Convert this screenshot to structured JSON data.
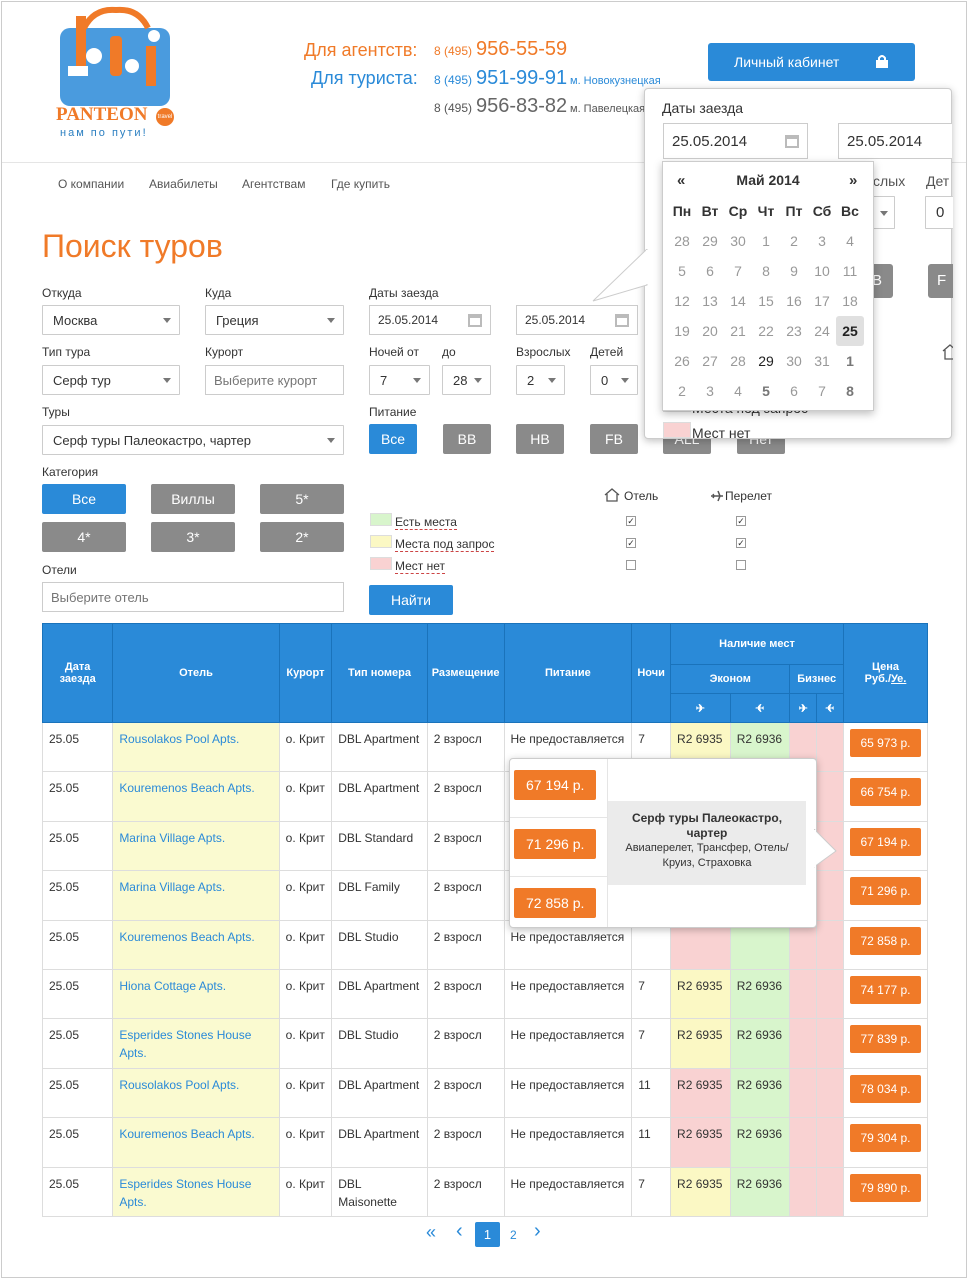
{
  "header": {
    "logo_text": "PANTEON",
    "logo_travel": "travel",
    "logo_slogan": "нам по пути!",
    "agency_label": "Для агентств:",
    "agency_code": "8 (495)",
    "agency_phone": "956-55-59",
    "tourist_label": "Для туриста:",
    "tourist_code": "8 (495)",
    "tourist_phone": "951-99-91",
    "tourist_metro": "м. Новокузнецкая",
    "phone3_code": "8 (495)",
    "phone3": "956-83-82",
    "phone3_metro": "м. Павелецкая",
    "cabinet_label": "Личный кабинет"
  },
  "nav": [
    "О компании",
    "Авиабилеты",
    "Агентствам",
    "Где купить"
  ],
  "page_title": "Поиск туров",
  "form": {
    "from_label": "Откуда",
    "from_value": "Москва",
    "to_label": "Куда",
    "to_value": "Греция",
    "dates_label": "Даты заезда",
    "date_from": "25.05.2014",
    "date_to": "25.05.2014",
    "tour_type_label": "Тип тура",
    "tour_type_value": "Серф тур",
    "resort_label": "Курорт",
    "resort_placeholder": "Выберите курорт",
    "nights_from_label": "Ночей от",
    "nights_from": "7",
    "nights_to_label": "до",
    "nights_to": "28",
    "adults_label": "Взрослых",
    "adults": "2",
    "children_label": "Детей",
    "children": "0",
    "tours_label": "Туры",
    "tours_value": "Серф туры Палеокастро, чартер",
    "meal_label": "Питание",
    "meal_buttons": [
      "Все",
      "BB",
      "HB",
      "FB",
      "ALL",
      "Нет"
    ],
    "category_label": "Категория",
    "category_buttons": [
      "Все",
      "Виллы",
      "5*",
      "4*",
      "3*",
      "2*"
    ],
    "hotels_label": "Отели",
    "hotels_placeholder": "Выберите отель",
    "legend": [
      "Есть места",
      "Места под запрос",
      "Мест нет"
    ],
    "hotel_col": "Отель",
    "flight_col": "Перелет",
    "search_button": "Найти"
  },
  "datepicker": {
    "label": "Даты заезда",
    "date_from": "25.05.2014",
    "date_to": "25.05.2014",
    "prev": "«",
    "next": "»",
    "month": "Май 2014",
    "weekdays": [
      "Пн",
      "Вт",
      "Ср",
      "Чт",
      "Пт",
      "Сб",
      "Вс"
    ],
    "weeks": [
      [
        "28",
        "29",
        "30",
        "1",
        "2",
        "3",
        "4"
      ],
      [
        "5",
        "6",
        "7",
        "8",
        "9",
        "10",
        "11"
      ],
      [
        "12",
        "13",
        "14",
        "15",
        "16",
        "17",
        "18"
      ],
      [
        "19",
        "20",
        "21",
        "22",
        "23",
        "24",
        "25"
      ],
      [
        "26",
        "27",
        "28",
        "29",
        "30",
        "31",
        "1"
      ],
      [
        "2",
        "3",
        "4",
        "5",
        "6",
        "7",
        "8"
      ]
    ],
    "peek_adults": "слых",
    "peek_children": "Дет",
    "peek_zero": "0",
    "peek_b": "B",
    "peek_f": "F",
    "peek_legend_request": "Места под запрос",
    "peek_legend_none": "Мест нет"
  },
  "table": {
    "headers": {
      "date": "Дата заезда",
      "hotel": "Отель",
      "resort": "Курорт",
      "room": "Тип номера",
      "place": "Размещение",
      "meal": "Питание",
      "nights": "Ночи",
      "avail": "Наличие мест",
      "econom": "Эконом",
      "business": "Бизнес",
      "price": "Цена",
      "price_cur": "Руб./",
      "price_cur2": "Уе."
    },
    "rows": [
      {
        "date": "25.05",
        "hotel": "Rousolakos Pool Apts.",
        "resort": "о. Крит",
        "room": "DBL Apartment",
        "place": "2 взросл",
        "meal": "Не предоставляется",
        "nights": "7",
        "e1": "R2 6935",
        "e2": "R2 6936",
        "c1": "y",
        "c2": "g",
        "price": "65 973 р."
      },
      {
        "date": "25.05",
        "hotel": "Kouremenos Beach Apts.",
        "resort": "о. Крит",
        "room": "DBL Apartment",
        "place": "2 взросл",
        "meal": "Не предоставляется",
        "nights": "",
        "e1": "",
        "e2": "",
        "c1": "y",
        "c2": "g",
        "price": "66 754 р."
      },
      {
        "date": "25.05",
        "hotel": "Marina Village Apts.",
        "resort": "о. Крит",
        "room": "DBL Standard",
        "place": "2 взросл",
        "meal": "",
        "nights": "",
        "e1": "",
        "e2": "",
        "c1": "y",
        "c2": "g",
        "price": "67 194 р."
      },
      {
        "date": "25.05",
        "hotel": "Marina Village Apts.",
        "resort": "о. Крит",
        "room": "DBL Family",
        "place": "2 взросл",
        "meal": "",
        "nights": "",
        "e1": "",
        "e2": "",
        "c1": "y",
        "c2": "g",
        "price": "71 296 р."
      },
      {
        "date": "25.05",
        "hotel": "Kouremenos Beach Apts.",
        "resort": "о. Крит",
        "room": "DBL Studio",
        "place": "2 взросл",
        "meal": "Не предоставляется",
        "nights": "",
        "e1": "",
        "e2": "",
        "c1": "r",
        "c2": "g",
        "price": "72 858 р."
      },
      {
        "date": "25.05",
        "hotel": "Hiona Cottage Apts.",
        "resort": "о. Крит",
        "room": "DBL Apartment",
        "place": "2 взросл",
        "meal": "Не предоставляется",
        "nights": "7",
        "e1": "R2 6935",
        "e2": "R2 6936",
        "c1": "y",
        "c2": "g",
        "price": "74 177 р."
      },
      {
        "date": "25.05",
        "hotel": "Esperides Stones House Apts.",
        "resort": "о. Крит",
        "room": "DBL Studio",
        "place": "2 взросл",
        "meal": "Не предоставляется",
        "nights": "7",
        "e1": "R2 6935",
        "e2": "R2 6936",
        "c1": "y",
        "c2": "g",
        "price": "77 839 р."
      },
      {
        "date": "25.05",
        "hotel": "Rousolakos Pool Apts.",
        "resort": "о. Крит",
        "room": "DBL Apartment",
        "place": "2 взросл",
        "meal": "Не предоставляется",
        "nights": "11",
        "e1": "R2 6935",
        "e2": "R2 6936",
        "c1": "r",
        "c2": "g",
        "price": "78 034 р."
      },
      {
        "date": "25.05",
        "hotel": "Kouremenos Beach Apts.",
        "resort": "о. Крит",
        "room": "DBL Apartment",
        "place": "2 взросл",
        "meal": "Не предоставляется",
        "nights": "11",
        "e1": "R2 6935",
        "e2": "R2 6936",
        "c1": "r",
        "c2": "g",
        "price": "79 304 р."
      },
      {
        "date": "25.05",
        "hotel": "Esperides Stones House Apts.",
        "resort": "о. Крит",
        "room": "DBL Maisonette",
        "place": "2 взросл",
        "meal": "Не предоставляется",
        "nights": "7",
        "e1": "R2 6935",
        "e2": "R2 6936",
        "c1": "y",
        "c2": "g",
        "price": "79 890 р."
      }
    ]
  },
  "price_popup": {
    "prices": [
      "67 194 р.",
      "71 296 р.",
      "72 858 р."
    ],
    "title": "Серф туры Палеокастро, чартер",
    "desc": "Авиаперелет, Трансфер, Отель/Круиз, Страховка"
  },
  "pager": {
    "first": "«",
    "prev": "‹",
    "pages": [
      "1",
      "2"
    ],
    "next": "›"
  },
  "colors": {
    "accent": "#f07a28",
    "blue": "#2a8ad8",
    "gray_btn": "#8a8a8a"
  }
}
